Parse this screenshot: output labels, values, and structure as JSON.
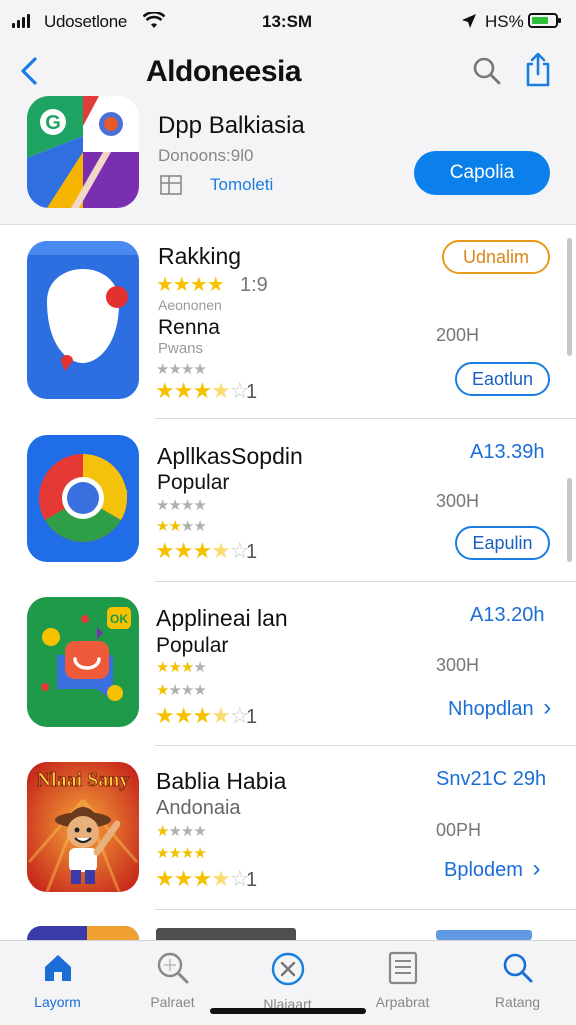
{
  "status_bar": {
    "carrier": "Udosetlone",
    "time": "13:SM",
    "battery": "HS%"
  },
  "nav": {
    "title": "Aldoneesia"
  },
  "featured": {
    "name": "Dpp Balkiasia",
    "downloads": "Donoons:9l0",
    "category": "Tomoleti",
    "get_label": "Capolia"
  },
  "apps": [
    {
      "name": "Rakking",
      "rating_count_top": "1:9",
      "sub_small": "Aeononen",
      "subtitle": "Renna",
      "sub_small2": "Pwans",
      "meta": "200H",
      "badge": "Udnalim",
      "action": "Eaotlun",
      "rating_count": "1",
      "rating": 3.5
    },
    {
      "name": "ApllkasSopdin",
      "subtitle": "Popular",
      "price": "A13.39h",
      "meta": "300H",
      "action": "Eapulin",
      "rating_count": "1",
      "rating": 3.5
    },
    {
      "name": "Applineai lan",
      "subtitle": "Popular",
      "price": "A13.20h",
      "meta": "300H",
      "action": "Nhopdlan",
      "rating_count": "1",
      "rating": 3.5
    },
    {
      "name": "Bablia Habia",
      "subtitle": "Andonaia",
      "price": "Snv21C 29h",
      "meta": "00PH",
      "action": "Bplodem",
      "rating_count": "1",
      "rating": 3.5,
      "icon_text": "Nlaai Sany"
    }
  ],
  "tabs": [
    {
      "label": "Layorm",
      "icon": "home-icon",
      "active": true
    },
    {
      "label": "Palraet",
      "icon": "search-magnifier-icon",
      "active": false
    },
    {
      "label": "Nlajaart",
      "icon": "close-circle-icon",
      "active": false
    },
    {
      "label": "Arpabrat",
      "icon": "document-icon",
      "active": false
    },
    {
      "label": "Ratang",
      "icon": "search-icon",
      "active": false
    }
  ],
  "colors": {
    "accent": "#0b80ea",
    "star": "#f6c200"
  }
}
